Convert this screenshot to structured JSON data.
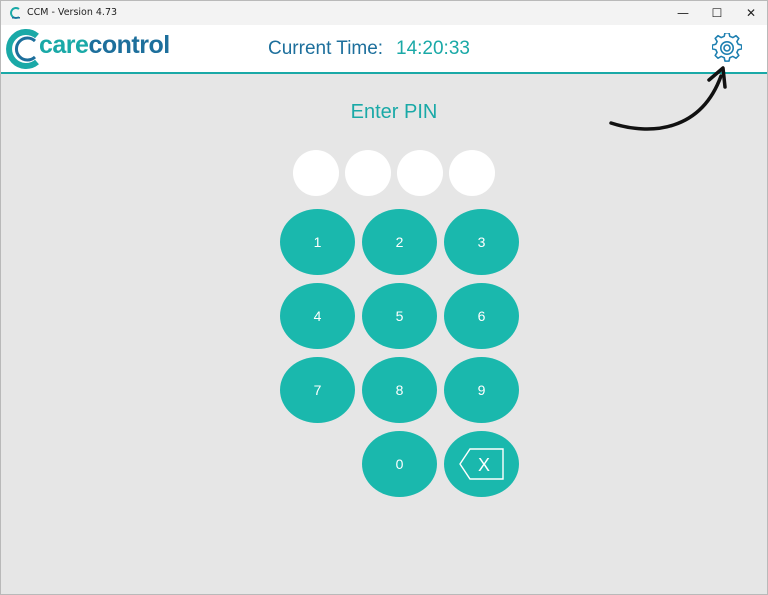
{
  "window": {
    "title": "CCM - Version 4.73",
    "controls": {
      "minimize": "—",
      "maximize": "☐",
      "close": "✕"
    }
  },
  "header": {
    "brand_part1": "care",
    "brand_part2": "control",
    "time_label": "Current Time:",
    "time_value": "14:20:33",
    "settings_icon": "gear-icon"
  },
  "pin": {
    "title": "Enter PIN",
    "entered_digits": 0,
    "max_digits": 4
  },
  "keypad": {
    "keys": [
      "1",
      "2",
      "3",
      "4",
      "5",
      "6",
      "7",
      "8",
      "9",
      "0"
    ],
    "backspace_label": "X"
  },
  "colors": {
    "teal": "#1aa9a7",
    "key_teal": "#1ab8ad",
    "blue": "#1d6f9c",
    "background": "#e6e6e6"
  }
}
